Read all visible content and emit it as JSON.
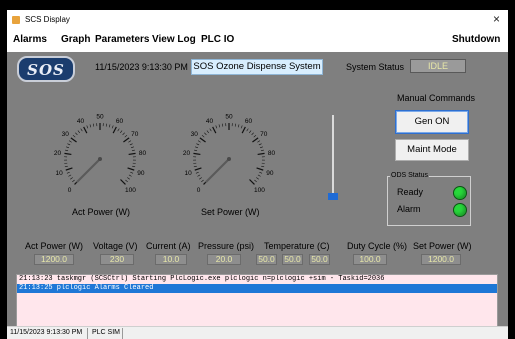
{
  "window": {
    "title": "SCS Display",
    "close_glyph": "×"
  },
  "menu": {
    "items": [
      "Alarms",
      "Graph",
      "Parameters",
      "View Log",
      "PLC IO"
    ],
    "right_item": "Shutdown"
  },
  "header": {
    "logo_text": "SOS",
    "datetime": "11/15/2023 9:13:30 PM",
    "system_name": "SOS Ozone Dispense System",
    "status_label": "System Status",
    "status_value": "IDLE"
  },
  "gauges": [
    {
      "caption": "Act Power (W)",
      "value": 0,
      "min": 0,
      "max": 100,
      "ticks": [
        "0",
        "10",
        "20",
        "30",
        "40",
        "50",
        "60",
        "70",
        "80",
        "90",
        "100"
      ]
    },
    {
      "caption": "Set Power (W)",
      "value": 0,
      "min": 0,
      "max": 100,
      "ticks": [
        "0",
        "10",
        "20",
        "30",
        "40",
        "50",
        "60",
        "70",
        "80",
        "90",
        "100"
      ]
    }
  ],
  "slider": {
    "value_fraction": 0.0
  },
  "manual": {
    "label": "Manual Commands",
    "gen_on": "Gen ON",
    "maint_mode": "Maint Mode"
  },
  "ods": {
    "title": "ODS Status",
    "ready": "Ready",
    "alarm": "Alarm",
    "ready_color": "#27d83b",
    "alarm_color": "#27d83b"
  },
  "readouts": [
    {
      "label": "Act Power (W)",
      "values": [
        "1200.0"
      ]
    },
    {
      "label": "Voltage (V)",
      "values": [
        "230"
      ]
    },
    {
      "label": "Current (A)",
      "values": [
        "10.0"
      ]
    },
    {
      "label": "Pressure (psi)",
      "values": [
        "20.0"
      ]
    },
    {
      "label": "Temperature (C)",
      "values": [
        "50.0",
        "50.0",
        "50.0"
      ]
    },
    {
      "label": "Duty Cycle (%)",
      "values": [
        "100.0"
      ]
    },
    {
      "label": "Set Power (W)",
      "values": [
        "1200.0"
      ]
    }
  ],
  "log": [
    {
      "text": "21:13:23 taskmgr (SCSCtrl) Starting PlcLogic.exe plclogic n=plclogic +sim - Taskid=2036",
      "selected": false
    },
    {
      "text": "21:13:25 plclogic Alarms Cleared",
      "selected": true
    }
  ],
  "statusbar": {
    "datetime": "11/15/2023 9:13:30 PM",
    "mode": "PLC SIM"
  }
}
